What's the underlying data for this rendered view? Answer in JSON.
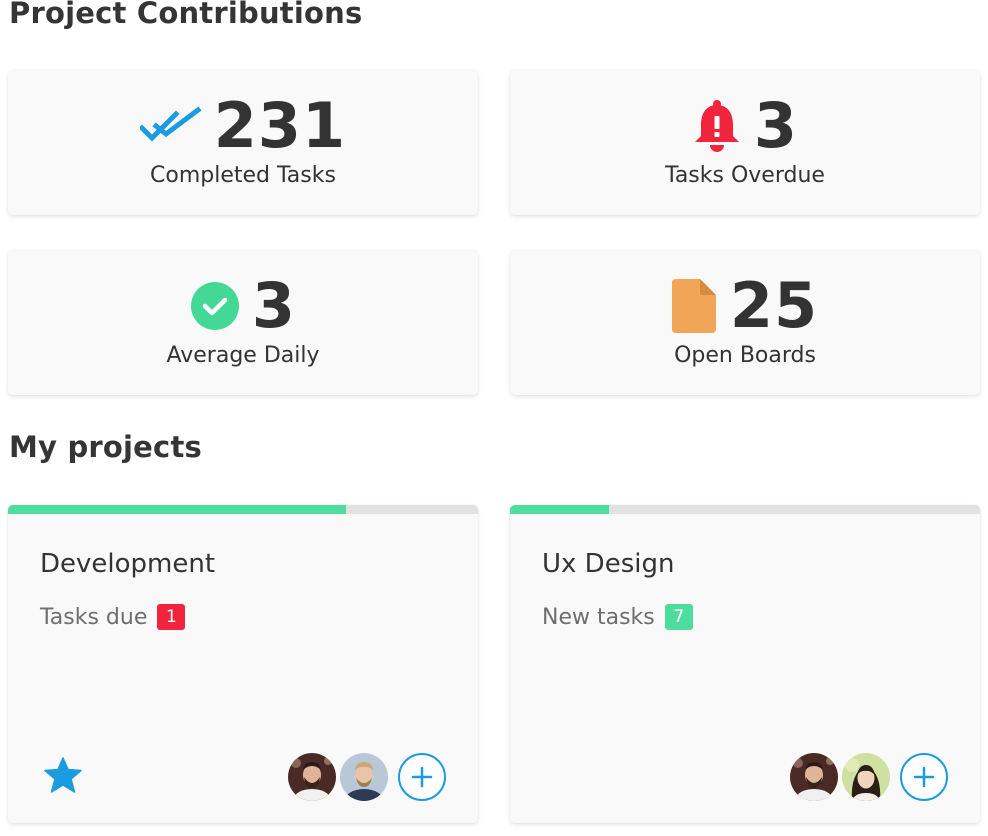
{
  "sections": {
    "contributions_title": "Project Contributions",
    "projects_title": "My projects"
  },
  "stats": [
    {
      "value": "231",
      "label": "Completed Tasks",
      "icon": "double-check-icon",
      "color": "#1b9be0"
    },
    {
      "value": "3",
      "label": "Tasks Overdue",
      "icon": "bell-icon",
      "color": "#f0243c"
    },
    {
      "value": "3",
      "label": "Average Daily",
      "icon": "check-circle-icon",
      "color": "#44d896"
    },
    {
      "value": "25",
      "label": "Open Boards",
      "icon": "document-icon",
      "color": "#f0a557"
    }
  ],
  "projects": [
    {
      "name": "Development",
      "task_label": "Tasks due",
      "badge": "1",
      "badge_color": "#f0243c",
      "progress": 0.72,
      "avatars": [
        "avatar-man-beard",
        "avatar-man-blond"
      ]
    },
    {
      "name": "Ux Design",
      "task_label": "New tasks",
      "badge": "7",
      "badge_color": "#4fdd9f",
      "progress": 0.21,
      "avatars": [
        "avatar-man-beard",
        "avatar-woman"
      ]
    }
  ],
  "colors": {
    "accent_blue": "#1b9be0",
    "progress_green": "#4fdd9f",
    "progress_track": "#e2e2e2"
  }
}
